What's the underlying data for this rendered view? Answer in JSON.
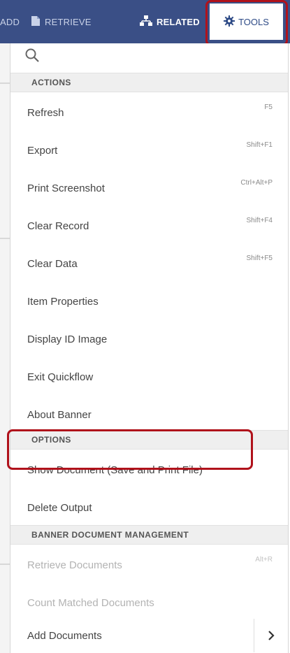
{
  "toolbar": {
    "add_label": "ADD",
    "retrieve_label": "RETRIEVE",
    "related_label": "RELATED",
    "tools_label": "TOOLS",
    "color": "#3a4f86",
    "icons": {
      "retrieve": "document-icon",
      "related": "sitemap-icon",
      "tools": "gear-icon"
    }
  },
  "menu": {
    "search_icon": "search-icon",
    "sections": [
      {
        "header": "ACTIONS",
        "items": [
          {
            "label": "Refresh",
            "shortcut": "F5"
          },
          {
            "label": "Export",
            "shortcut": "Shift+F1"
          },
          {
            "label": "Print Screenshot",
            "shortcut": "Ctrl+Alt+P"
          },
          {
            "label": "Clear Record",
            "shortcut": "Shift+F4"
          },
          {
            "label": "Clear Data",
            "shortcut": "Shift+F5"
          },
          {
            "label": "Item Properties"
          },
          {
            "label": "Display ID Image"
          },
          {
            "label": "Exit Quickflow"
          },
          {
            "label": "About Banner"
          }
        ]
      },
      {
        "header": "OPTIONS",
        "items": [
          {
            "label": "Show Document (Save and Print File)"
          },
          {
            "label": "Delete Output"
          }
        ]
      },
      {
        "header": "BANNER DOCUMENT MANAGEMENT",
        "items": [
          {
            "label": "Retrieve Documents",
            "shortcut": "Alt+R",
            "disabled": true
          },
          {
            "label": "Count Matched Documents",
            "disabled": true
          },
          {
            "label": "Add Documents",
            "submenu_icon": "chevron-right-icon"
          }
        ]
      }
    ]
  },
  "highlight_color": "#b0121b"
}
